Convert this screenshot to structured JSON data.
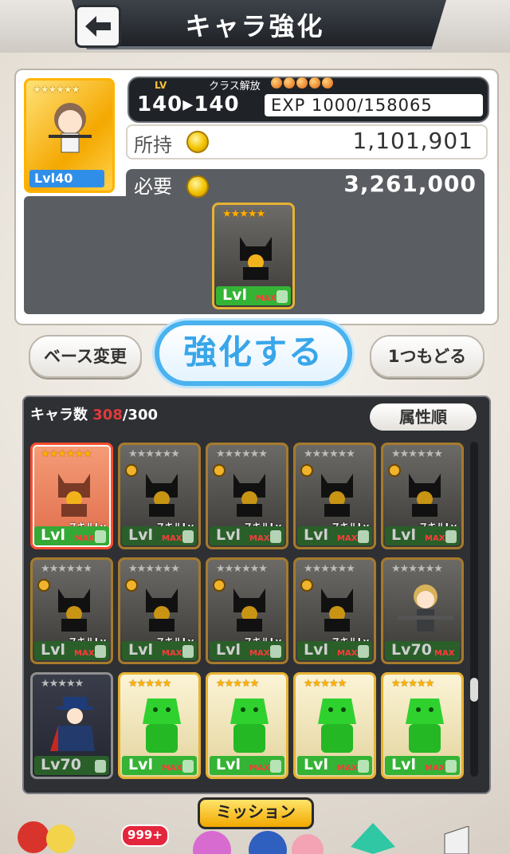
{
  "header": {
    "title": "キャラ強化"
  },
  "base_char": {
    "level_label": "Lvl40",
    "stars": "★★★★★★"
  },
  "level_box": {
    "lv_tag": "LV",
    "class_release_label": "クラス解放",
    "level_text": "140▸140",
    "exp_text": "EXP  1000/158065"
  },
  "owned": {
    "label": "所持",
    "value": "1,101,901"
  },
  "required": {
    "label": "必要",
    "value": "3,261,000"
  },
  "material_card": {
    "level_label": "Lvl",
    "max_label": "MAX",
    "stars": "★★★★★"
  },
  "buttons": {
    "change_base": "ベース変更",
    "enhance": "強化する",
    "undo": "1つもどる"
  },
  "list": {
    "count_label": "キャラ数",
    "count_current": "308",
    "count_max": "/300",
    "sort_label": "属性順"
  },
  "card_text": {
    "stars6": "★★★★★★",
    "stars5": "★★★★★",
    "skill": "スキルLv",
    "lvl": "Lvl",
    "lv70": "Lv70",
    "max": "MAX"
  },
  "nav": {
    "mission_label": "ミッション",
    "badge": "999+"
  },
  "colors": {
    "accent": "#4ab2ee",
    "danger": "#e23a3a",
    "gold": "#f2c200"
  }
}
